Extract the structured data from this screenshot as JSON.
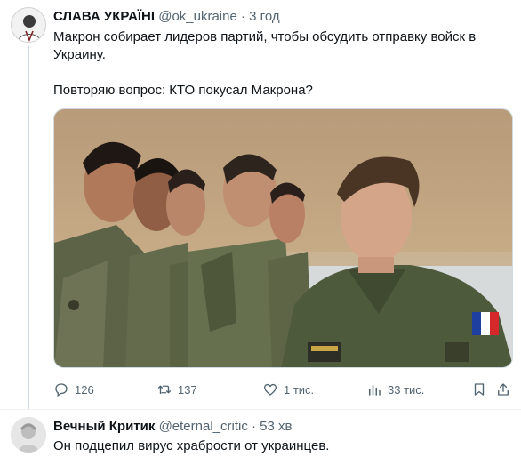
{
  "tweet": {
    "author_name": "СЛАВА УКРАЇНІ",
    "author_handle": "@ok_ukraine",
    "separator": "·",
    "time": "3 год",
    "text_line1": "Макрон собирает лидеров партий, чтобы обсудить отправку войск в Украину.",
    "text_line2": "Повторяю вопрос: КТО покусал Макрона?",
    "actions": {
      "replies": "126",
      "retweets": "137",
      "likes": "1 тис.",
      "views": "33 тис."
    }
  },
  "reply": {
    "author_name": "Вечный Критик",
    "author_handle": "@eternal_critic",
    "separator": "·",
    "time": "53 хв",
    "text": "Он подцепил вирус храбрости от украинцев."
  },
  "colors": {
    "text_primary": "#0f1419",
    "text_secondary": "#536471",
    "border": "#cfd9de",
    "background": "#ffffff"
  },
  "icons": {
    "reply": "reply-icon",
    "retweet": "retweet-icon",
    "like": "heart-icon",
    "views": "views-icon",
    "bookmark": "bookmark-icon",
    "share": "share-icon"
  }
}
